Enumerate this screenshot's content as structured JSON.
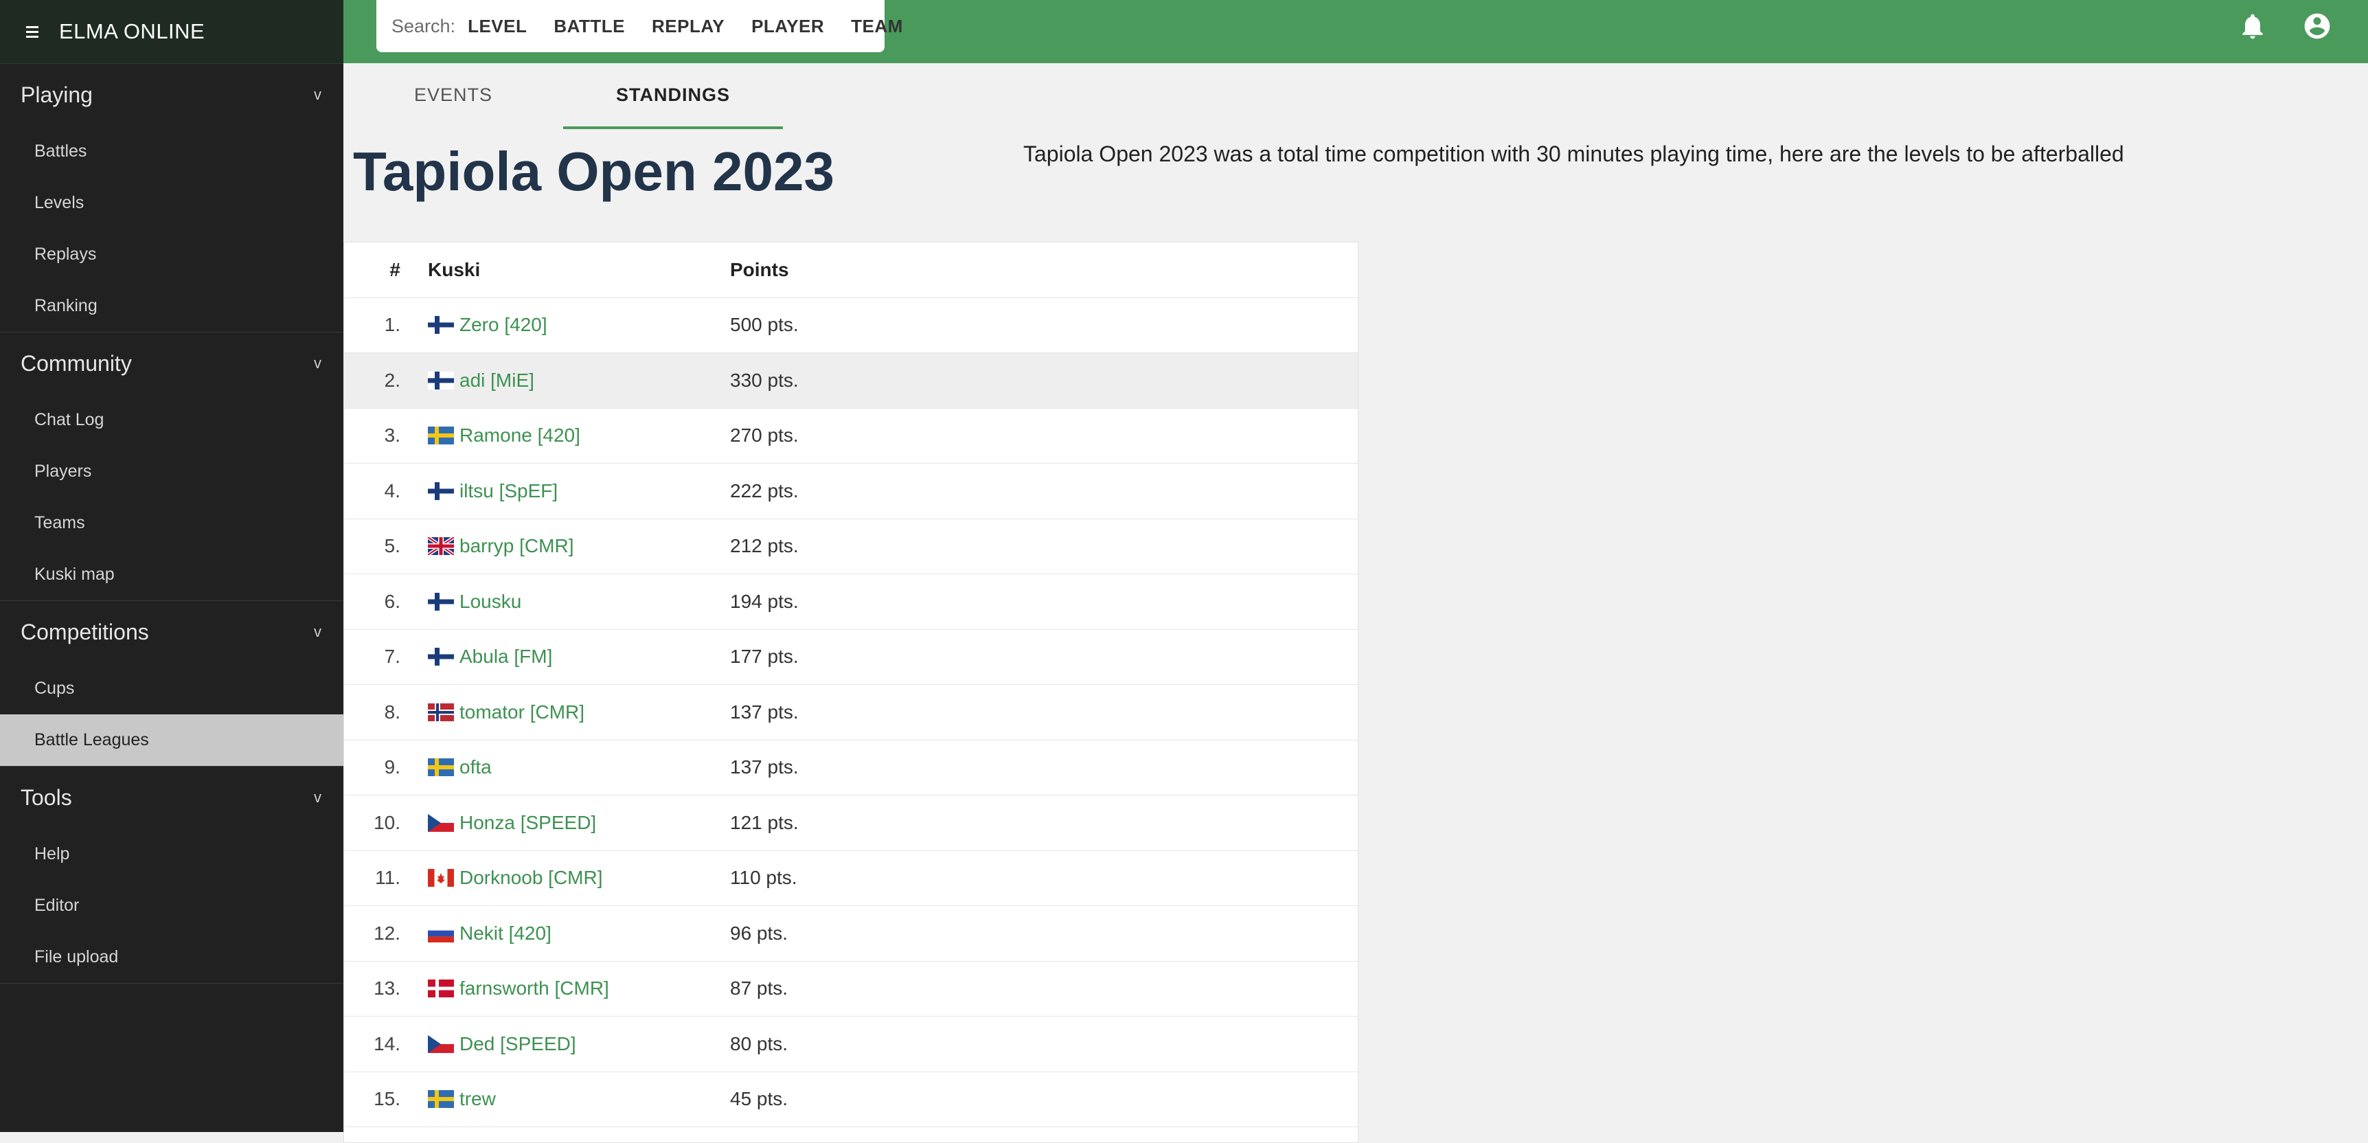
{
  "app": {
    "title": "ELMA ONLINE"
  },
  "sidebar": {
    "sections": [
      {
        "label": "Playing",
        "items": [
          "Battles",
          "Levels",
          "Replays",
          "Ranking"
        ]
      },
      {
        "label": "Community",
        "items": [
          "Chat Log",
          "Players",
          "Teams",
          "Kuski map"
        ]
      },
      {
        "label": "Competitions",
        "items": [
          "Cups",
          "Battle Leagues"
        ]
      },
      {
        "label": "Tools",
        "items": [
          "Help",
          "Editor",
          "File upload"
        ]
      }
    ],
    "active_item": "Battle Leagues",
    "chevron": "v"
  },
  "search": {
    "label": "Search:",
    "options": [
      "LEVEL",
      "BATTLE",
      "REPLAY",
      "PLAYER",
      "TEAM"
    ]
  },
  "topbar": {
    "icons": [
      "bell-icon",
      "account-circle-icon"
    ],
    "color": "#4a9a5c"
  },
  "tabs": [
    "EVENTS",
    "STANDINGS"
  ],
  "active_tab": "STANDINGS",
  "page": {
    "title": "Tapiola Open 2023",
    "description": "Tapiola Open 2023 was a total time competition with 30 minutes playing time, here are the levels to be afterballed"
  },
  "table": {
    "headers": {
      "rank": "#",
      "kuski": "Kuski",
      "points": "Points"
    },
    "rows": [
      {
        "rank": "1.",
        "flag": "fi",
        "name": "Zero [420]",
        "points": "500 pts."
      },
      {
        "rank": "2.",
        "flag": "fi",
        "name": "adi [MiE]",
        "points": "330 pts."
      },
      {
        "rank": "3.",
        "flag": "se",
        "name": "Ramone [420]",
        "points": "270 pts."
      },
      {
        "rank": "4.",
        "flag": "fi",
        "name": "iltsu [SpEF]",
        "points": "222 pts."
      },
      {
        "rank": "5.",
        "flag": "gb",
        "name": "barryp [CMR]",
        "points": "212 pts."
      },
      {
        "rank": "6.",
        "flag": "fi",
        "name": "Lousku",
        "points": "194 pts."
      },
      {
        "rank": "7.",
        "flag": "fi",
        "name": "Abula [FM]",
        "points": "177 pts."
      },
      {
        "rank": "8.",
        "flag": "no",
        "name": "tomator [CMR]",
        "points": "137 pts."
      },
      {
        "rank": "9.",
        "flag": "se",
        "name": "ofta",
        "points": "137 pts."
      },
      {
        "rank": "10.",
        "flag": "cz",
        "name": "Honza [SPEED]",
        "points": "121 pts."
      },
      {
        "rank": "11.",
        "flag": "ca",
        "name": "Dorknoob [CMR]",
        "points": "110 pts."
      },
      {
        "rank": "12.",
        "flag": "ru",
        "name": "Nekit [420]",
        "points": "96 pts."
      },
      {
        "rank": "13.",
        "flag": "dk",
        "name": "farnsworth [CMR]",
        "points": "87 pts."
      },
      {
        "rank": "14.",
        "flag": "cz",
        "name": "Ded [SPEED]",
        "points": "80 pts."
      },
      {
        "rank": "15.",
        "flag": "se",
        "name": "trew",
        "points": "45 pts."
      }
    ],
    "highlighted_rank": "2.",
    "link_color": "#3d9151"
  }
}
